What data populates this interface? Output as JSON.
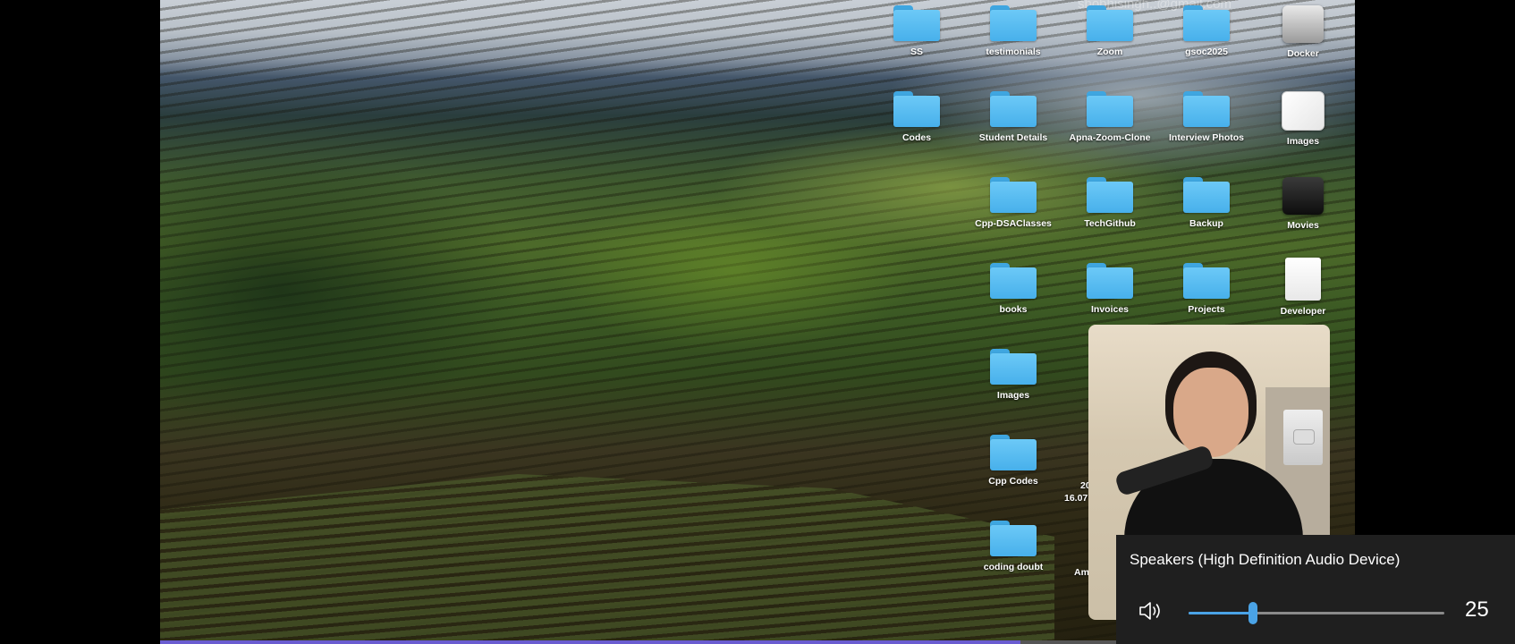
{
  "overlay": {
    "email": "shobhisingh..@gmail.com"
  },
  "desktop": {
    "icons": [
      {
        "label": "SS",
        "kind": "folder"
      },
      {
        "label": "testimonials",
        "kind": "folder"
      },
      {
        "label": "Zoom",
        "kind": "folder"
      },
      {
        "label": "gsoc2025",
        "kind": "folder"
      },
      {
        "label": "Docker",
        "kind": "app",
        "icon": "docker-app-icon"
      },
      {
        "label": "Codes",
        "kind": "folder"
      },
      {
        "label": "Student Details",
        "kind": "folder"
      },
      {
        "label": "Apna-Zoom-Clone",
        "kind": "folder"
      },
      {
        "label": "Interview Photos",
        "kind": "folder"
      },
      {
        "label": "Images",
        "kind": "app",
        "icon": "images-file-icon"
      },
      {
        "label": "Cpp-DSAClasses",
        "kind": "folder"
      },
      {
        "label": "TechGithub",
        "kind": "folder"
      },
      {
        "label": "Backup",
        "kind": "folder"
      },
      {
        "label": "Movies",
        "kind": "app",
        "icon": "movies-file-icon"
      },
      {
        "label": "books",
        "kind": "folder"
      },
      {
        "label": "Invoices",
        "kind": "folder"
      },
      {
        "label": "Projects",
        "kind": "folder"
      },
      {
        "label": "Developer",
        "kind": "app",
        "icon": "java-file-icon"
      },
      {
        "label": "Images",
        "kind": "folder"
      },
      {
        "label": "Cpp Codes",
        "kind": "folder"
      },
      {
        "label": "coding doubt",
        "kind": "folder"
      }
    ],
    "partial_labels": [
      "20",
      "16.07",
      "Am"
    ]
  },
  "volume_flyout": {
    "device": "Speakers (High Definition Audio Device)",
    "level": 25,
    "level_text": "25",
    "accent_color": "#4aa3e6"
  }
}
